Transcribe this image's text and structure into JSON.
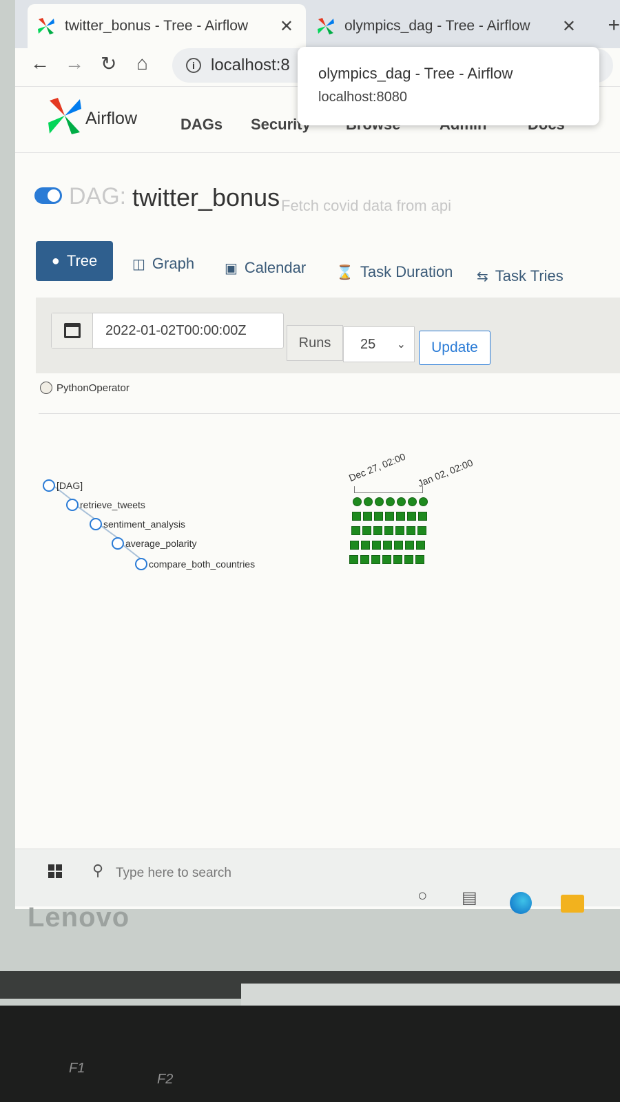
{
  "browser": {
    "tabs": [
      {
        "title": "twitter_bonus - Tree - Airflow",
        "close": "✕"
      },
      {
        "title": "olympics_dag - Tree - Airflow",
        "close": "✕"
      }
    ],
    "new_tab": "+",
    "address": "localhost:8",
    "tooltip": {
      "title": "olympics_dag - Tree - Airflow",
      "url": "localhost:8080"
    }
  },
  "navbar": {
    "brand": "Airflow",
    "items": [
      "DAGs",
      "Security",
      "Browse",
      "Admin",
      "Docs"
    ]
  },
  "dag": {
    "prefix": "DAG:",
    "name": "twitter_bonus",
    "description": "Fetch covid data from api"
  },
  "view_tabs": [
    "Tree",
    "Graph",
    "Calendar",
    "Task Duration",
    "Task Tries"
  ],
  "controls": {
    "base_date": "2022-01-02T00:00:00Z",
    "runs_label": "Runs",
    "runs_value": "25",
    "update_label": "Update"
  },
  "legend": {
    "operator": "PythonOperator"
  },
  "tree": {
    "nodes": [
      "[DAG]",
      "retrieve_tweets",
      "sentiment_analysis",
      "average_polarity",
      "compare_both_countries"
    ],
    "dates": [
      "Dec 27, 02:00",
      "Jan 02, 02:00"
    ],
    "run_count": 7,
    "status_color": "#1e8a1e"
  },
  "taskbar": {
    "search_placeholder": "Type here to search"
  },
  "device": {
    "brand": "Lenovo",
    "fkeys": [
      "F1",
      "F2"
    ]
  },
  "colors": {
    "primary": "#2f5f8e",
    "link": "#2a7bd6",
    "success": "#1e8a1e"
  }
}
